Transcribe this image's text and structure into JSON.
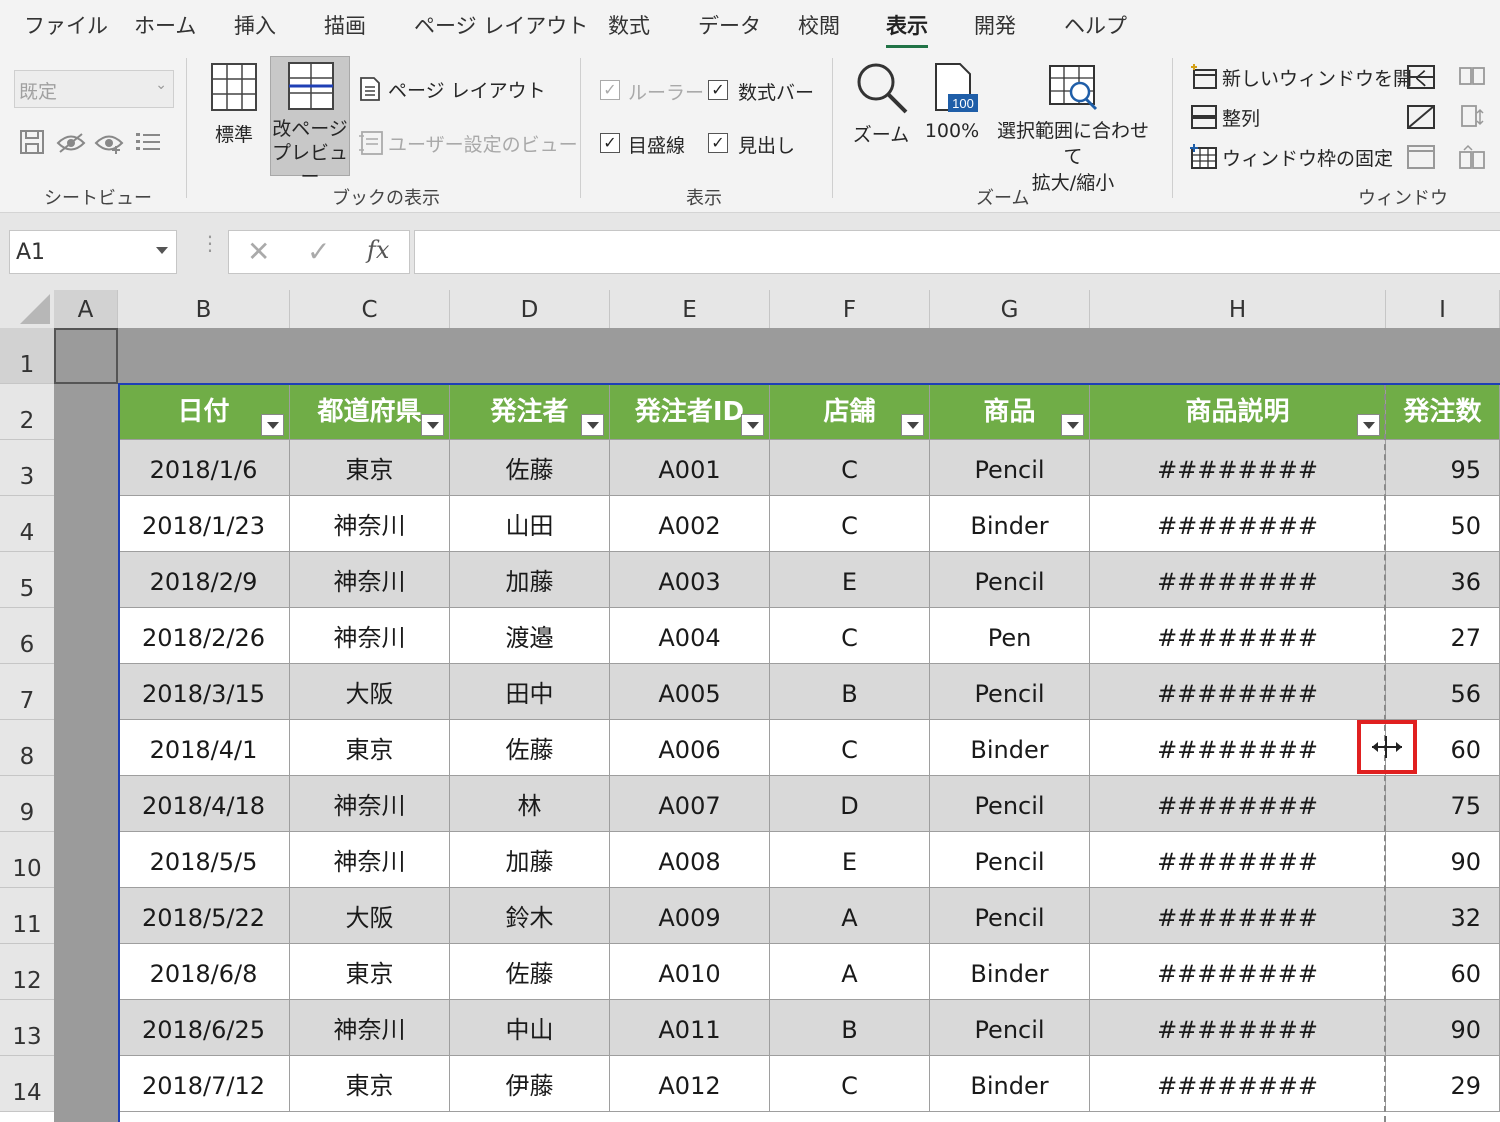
{
  "menu": {
    "tabs": [
      "ファイル",
      "ホーム",
      "挿入",
      "描画",
      "ページ レイアウト",
      "数式",
      "データ",
      "校閲",
      "表示",
      "開発",
      "ヘルプ"
    ],
    "active": "表示"
  },
  "ribbon": {
    "sheet_view": {
      "dropdown_value": "既定",
      "label": "シートビュー"
    },
    "workbook_views": {
      "normal": "標準",
      "page_break_preview": "改ページ\nプレビュー",
      "page_layout": "ページ レイアウト",
      "custom_views": "ユーザー設定のビュー",
      "label": "ブックの表示"
    },
    "show": {
      "ruler": "ルーラー",
      "formula_bar": "数式バー",
      "gridlines": "目盛線",
      "headings": "見出し",
      "label": "表示"
    },
    "zoom": {
      "zoom": "ズーム",
      "zoom100": "100%",
      "zoom_sel": "選択範囲に合わせて\n拡大/縮小",
      "icon_text": "100",
      "label": "ズーム"
    },
    "window": {
      "new_window": "新しいウィンドウを開く",
      "arrange": "整列",
      "freeze": "ウィンドウ枠の固定",
      "label": "ウィンドウ"
    }
  },
  "formula_bar": {
    "name_box": "A1",
    "fx": "fx",
    "content": ""
  },
  "grid": {
    "columns": [
      "A",
      "B",
      "C",
      "D",
      "E",
      "F",
      "G",
      "H",
      "I"
    ],
    "rows": [
      "1",
      "2",
      "3",
      "4",
      "5",
      "6",
      "7",
      "8",
      "9",
      "10",
      "11",
      "12",
      "13",
      "14"
    ],
    "header": [
      "日付",
      "都道府県",
      "発注者",
      "発注者ID",
      "店舗",
      "商品",
      "商品説明",
      "発注数"
    ],
    "data": [
      [
        "2018/1/6",
        "東京",
        "佐藤",
        "A001",
        "C",
        "Pencil",
        "########",
        "95"
      ],
      [
        "2018/1/23",
        "神奈川",
        "山田",
        "A002",
        "C",
        "Binder",
        "########",
        "50"
      ],
      [
        "2018/2/9",
        "神奈川",
        "加藤",
        "A003",
        "E",
        "Pencil",
        "########",
        "36"
      ],
      [
        "2018/2/26",
        "神奈川",
        "渡邉",
        "A004",
        "C",
        "Pen",
        "########",
        "27"
      ],
      [
        "2018/3/15",
        "大阪",
        "田中",
        "A005",
        "B",
        "Pencil",
        "########",
        "56"
      ],
      [
        "2018/4/1",
        "東京",
        "佐藤",
        "A006",
        "C",
        "Binder",
        "########",
        "60"
      ],
      [
        "2018/4/18",
        "神奈川",
        "林",
        "A007",
        "D",
        "Pencil",
        "########",
        "75"
      ],
      [
        "2018/5/5",
        "神奈川",
        "加藤",
        "A008",
        "E",
        "Pencil",
        "########",
        "90"
      ],
      [
        "2018/5/22",
        "大阪",
        "鈴木",
        "A009",
        "A",
        "Pencil",
        "########",
        "32"
      ],
      [
        "2018/6/8",
        "東京",
        "佐藤",
        "A010",
        "A",
        "Binder",
        "########",
        "60"
      ],
      [
        "2018/6/25",
        "神奈川",
        "中山",
        "A011",
        "B",
        "Pencil",
        "########",
        "90"
      ],
      [
        "2018/7/12",
        "東京",
        "伊藤",
        "A012",
        "C",
        "Binder",
        "########",
        "29"
      ]
    ]
  },
  "colors": {
    "header_green": "#70ad47",
    "band_gray": "#d9d9d9",
    "page_break_gray": "#9b9b9b",
    "print_area_blue": "#1f3fb5",
    "highlight_red": "#e02020"
  }
}
